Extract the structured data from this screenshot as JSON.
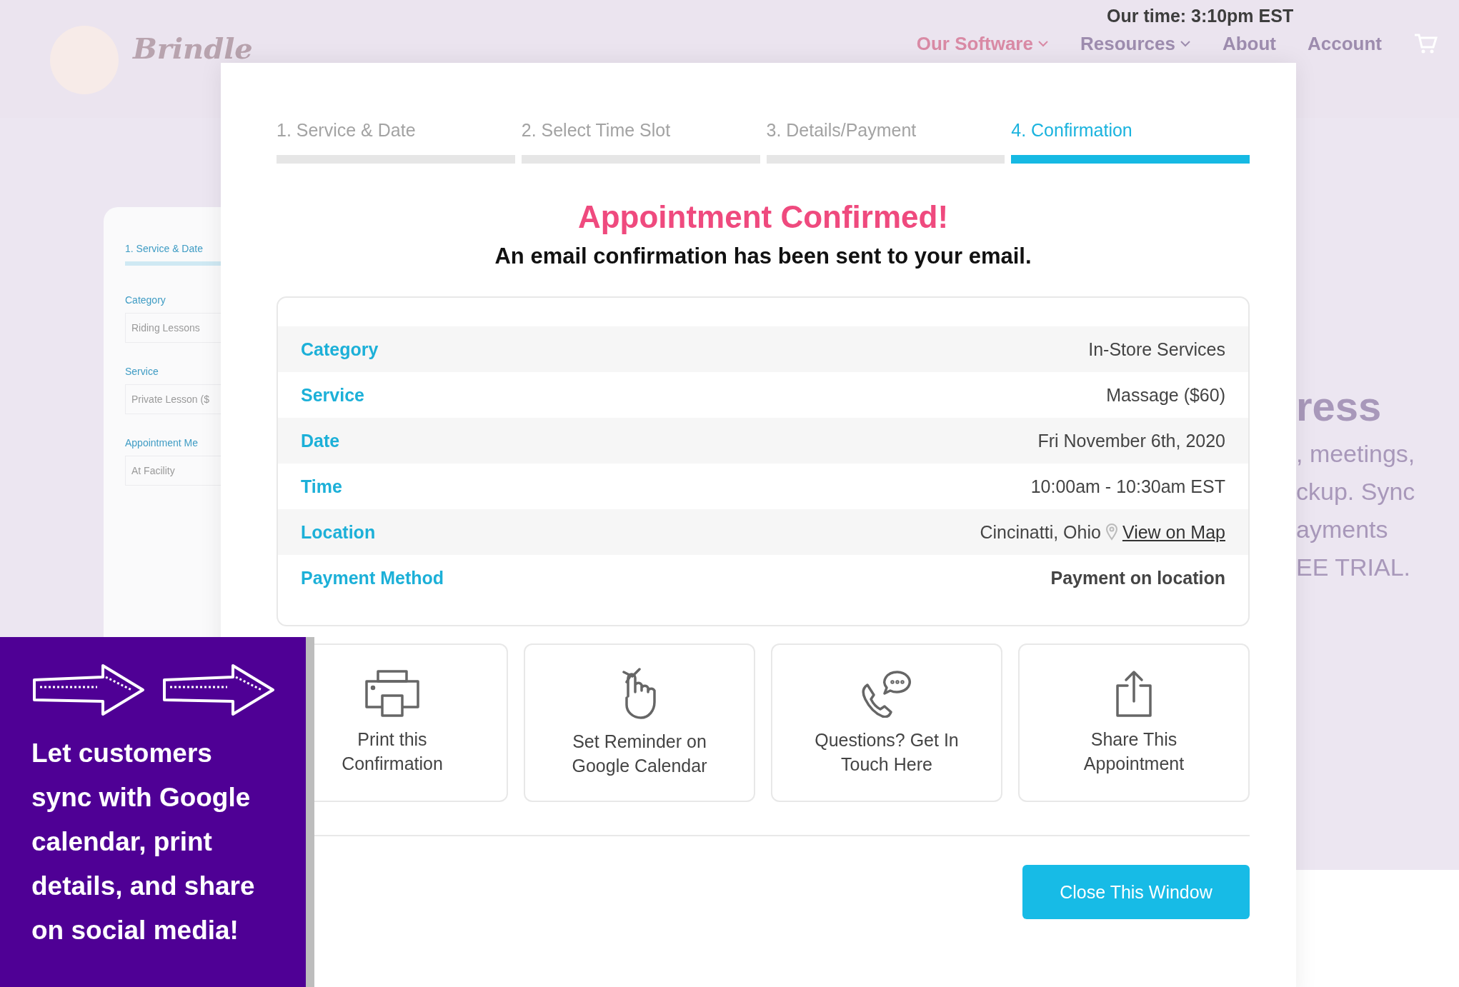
{
  "site_header": {
    "logo_text": "Brindle",
    "local_time": "Our time: 3:10pm EST",
    "nav": [
      {
        "label": "Our Software",
        "selected": true,
        "dropdown": true
      },
      {
        "label": "Resources",
        "selected": false,
        "dropdown": true
      },
      {
        "label": "About",
        "selected": false,
        "dropdown": false
      },
      {
        "label": "Account",
        "selected": false,
        "dropdown": false
      }
    ]
  },
  "background_form": {
    "step": "1. Service & Date",
    "fields": [
      {
        "label": "Category",
        "value": "Riding Lessons"
      },
      {
        "label": "Service",
        "value": "Private Lesson ($"
      },
      {
        "label": "Appointment Me",
        "value": "At Facility"
      }
    ]
  },
  "background_promo": {
    "heading": "ress",
    "lines": [
      ", meetings,",
      "ckup. Sync",
      "ayments",
      "EE TRIAL."
    ]
  },
  "modal": {
    "steps": [
      {
        "label": "1. Service & Date",
        "selected": false
      },
      {
        "label": "2. Select Time Slot",
        "selected": false
      },
      {
        "label": "3. Details/Payment",
        "selected": false
      },
      {
        "label": "4. Confirmation",
        "selected": true
      }
    ],
    "title": "Appointment Confirmed!",
    "subtitle": "An email confirmation has been sent to your email.",
    "details": [
      {
        "kind": "text",
        "label": "Category",
        "value": "In-Store Services"
      },
      {
        "kind": "text",
        "label": "Service",
        "value": "Massage ($60)"
      },
      {
        "kind": "text",
        "label": "Date",
        "value": "Fri November 6th, 2020"
      },
      {
        "kind": "text",
        "label": "Time",
        "value": "10:00am - 10:30am EST"
      },
      {
        "kind": "location",
        "label": "Location",
        "value": "Cincinatti, Ohio",
        "link": "View on Map"
      },
      {
        "kind": "bold",
        "label": "Payment Method",
        "value": "Payment on location"
      }
    ],
    "actions": [
      {
        "kind": "print",
        "label": "Print this Confirmation"
      },
      {
        "kind": "reminder",
        "label": "Set Reminder on Google Calendar"
      },
      {
        "kind": "contact",
        "label": "Questions? Get In Touch Here"
      },
      {
        "kind": "share",
        "label": "Share This Appointment"
      }
    ],
    "close_button": "Close This Window"
  },
  "callout": {
    "text": "Let customers sync with Google calendar, print details, and share on social media!"
  }
}
